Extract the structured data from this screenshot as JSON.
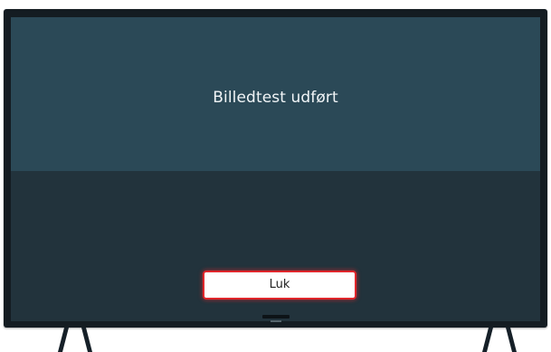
{
  "dialog": {
    "message": "Billedtest udført",
    "close_label": "Luk"
  },
  "colors": {
    "bezel": "#141c22",
    "screen_top": "#2b4957",
    "screen_bottom": "#22333c",
    "button_focus_border": "#e0262b",
    "button_bg": "#ffffff"
  },
  "icons": {
    "stand_legs": "tv-stand-leg-icon"
  }
}
